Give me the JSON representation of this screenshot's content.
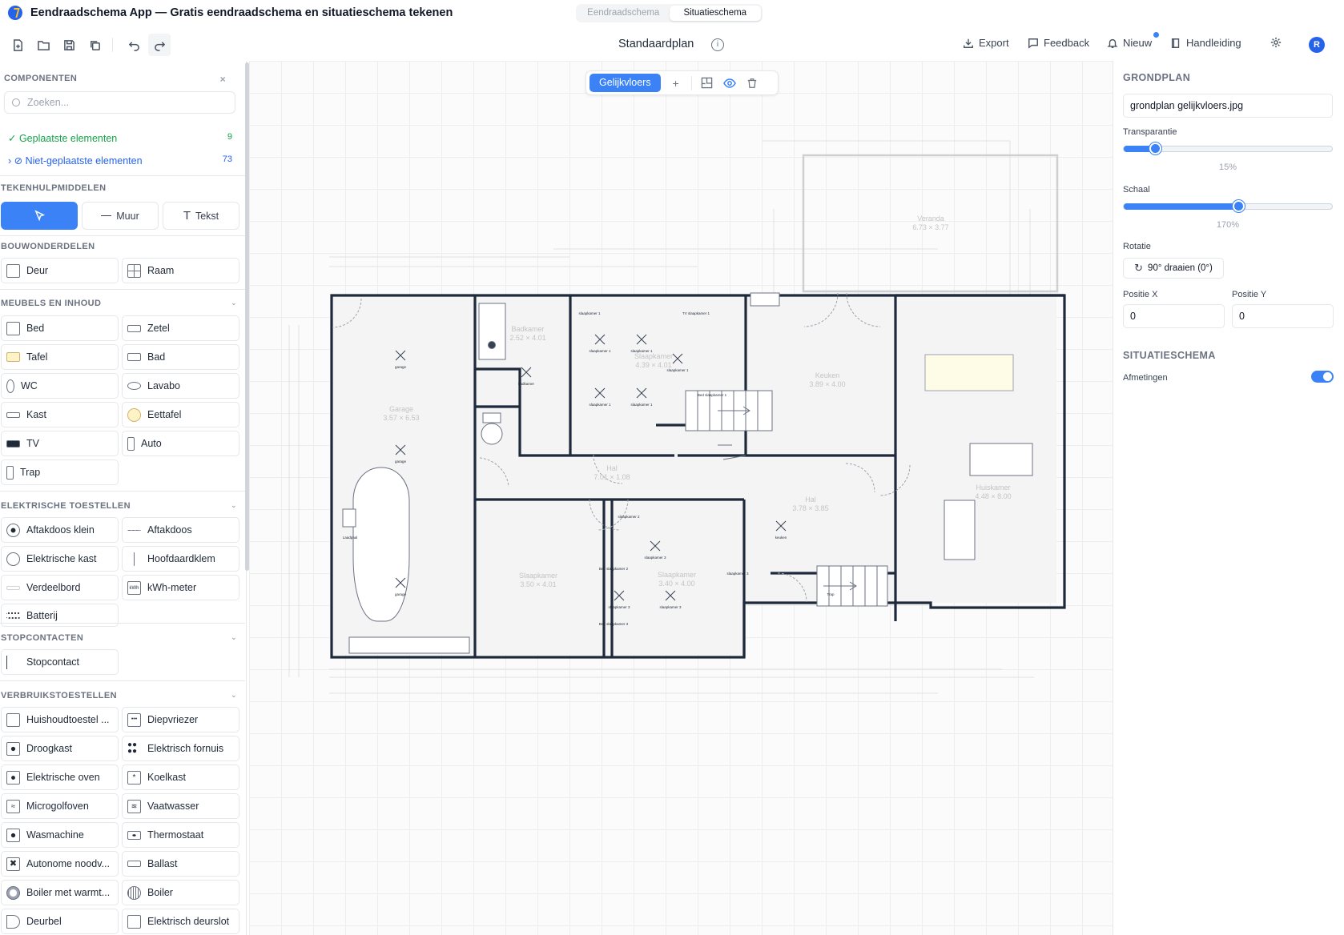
{
  "app": {
    "title": "Eendraadschema App — Gratis eendraadschema en situatieschema tekenen"
  },
  "modes": {
    "tab1": "Eendraadschema",
    "tab2": "Situatieschema"
  },
  "toolbar": {
    "plan_title": "Standaardplan",
    "export": "Export",
    "feedback": "Feedback",
    "nieuw": "Nieuw",
    "handleiding": "Handleiding",
    "avatar": "R"
  },
  "sidebar": {
    "componenten": "COMPONENTEN",
    "search_placeholder": "Zoeken...",
    "placed_label": "Geplaatste elementen",
    "placed_count": "9",
    "unplaced_label": "Niet-geplaatste elementen",
    "unplaced_count": "73",
    "tekenhulp": "TEKENHULPMIDDELEN",
    "tool_wall": "Muur",
    "tool_text": "Tekst",
    "bouw": "BOUWONDERDELEN",
    "bouw_items": [
      "Deur",
      "Raam"
    ],
    "meubels": "MEUBELS EN INHOUD",
    "meubels_items": [
      "Bed",
      "Zetel",
      "Tafel",
      "Bad",
      "WC",
      "Lavabo",
      "Kast",
      "Eettafel",
      "TV",
      "Auto",
      "Trap"
    ],
    "elek": "ELEKTRISCHE TOESTELLEN",
    "elek_items": [
      "Aftakdoos klein",
      "Aftakdoos",
      "Elektrische kast",
      "Hoofdaardklem",
      "Verdeelbord",
      "kWh-meter",
      "Batterij"
    ],
    "stop": "STOPCONTACTEN",
    "stop_items": [
      "Stopcontact"
    ],
    "verbruik": "VERBRUIKSTOESTELLEN",
    "verbruik_items": [
      "Huishoudtoestel ...",
      "Diepvriezer",
      "Droogkast",
      "Elektrisch fornuis",
      "Elektrische oven",
      "Koelkast",
      "Microgolfoven",
      "Vaatwasser",
      "Wasmachine",
      "Thermostaat",
      "Autonome noodv...",
      "Ballast",
      "Boiler met warmt...",
      "Boiler",
      "Deurbel",
      "Elektrisch deurslot"
    ]
  },
  "floorbar": {
    "active": "Gelijkvloers",
    "add": "+"
  },
  "plan": {
    "rooms": [
      {
        "name": "Garage",
        "size": "3.57 × 6.53"
      },
      {
        "name": "Badkamer",
        "size": "2.52 × 4.01"
      },
      {
        "name": "Slaapkamer",
        "size": "4.39 × 4.01"
      },
      {
        "name": "Keuken",
        "size": "3.89 × 4.00"
      },
      {
        "name": "Veranda",
        "size": "6.73 × 3.77"
      },
      {
        "name": "Hal",
        "size": "7.01 × 1.08"
      },
      {
        "name": "Hal",
        "size": "3.78 × 3.85"
      },
      {
        "name": "Slaapkamer",
        "size": "3.50 × 4.01"
      },
      {
        "name": "Slaapkamer",
        "size": "3.40 × 4.00"
      },
      {
        "name": "Huiskamer",
        "size": "4.48 × 8.00"
      }
    ],
    "labels": {
      "garage": "garage",
      "badkamer": "badkamer",
      "slaapkamer1": "slaapkamer 1",
      "tv": "TV slaapkamer 1",
      "bed1": "Bed slaapkamer 1",
      "slaapkamer2": "slaapkamer 2",
      "slaapkamer3": "slaapkamer 3",
      "bed2": "Bed slaapkamer 2",
      "bed3": "Bed slaapkamer 3",
      "laadpaal": "Laadpaal",
      "keuken": "keuken",
      "trap": "Trap"
    }
  },
  "rpanel": {
    "grondplan": "GRONDPLAN",
    "file": "grondplan gelijkvloers.jpg",
    "transparantie": "Transparantie",
    "trans_val": "15%",
    "trans_frac": 0.15,
    "schaal": "Schaal",
    "schaal_val": "170%",
    "schaal_frac": 0.55,
    "rotatie": "Rotatie",
    "rot_btn": "90° draaien (0°)",
    "posx": "Positie X",
    "posx_val": "0",
    "posy": "Positie Y",
    "posy_val": "0",
    "situatie": "SITUATIESCHEMA",
    "afmetingen": "Afmetingen"
  },
  "colors": {
    "accent": "#3b82f6",
    "wall": "#1e293b",
    "placed": "#16a34a",
    "unplaced": "#2563eb"
  }
}
